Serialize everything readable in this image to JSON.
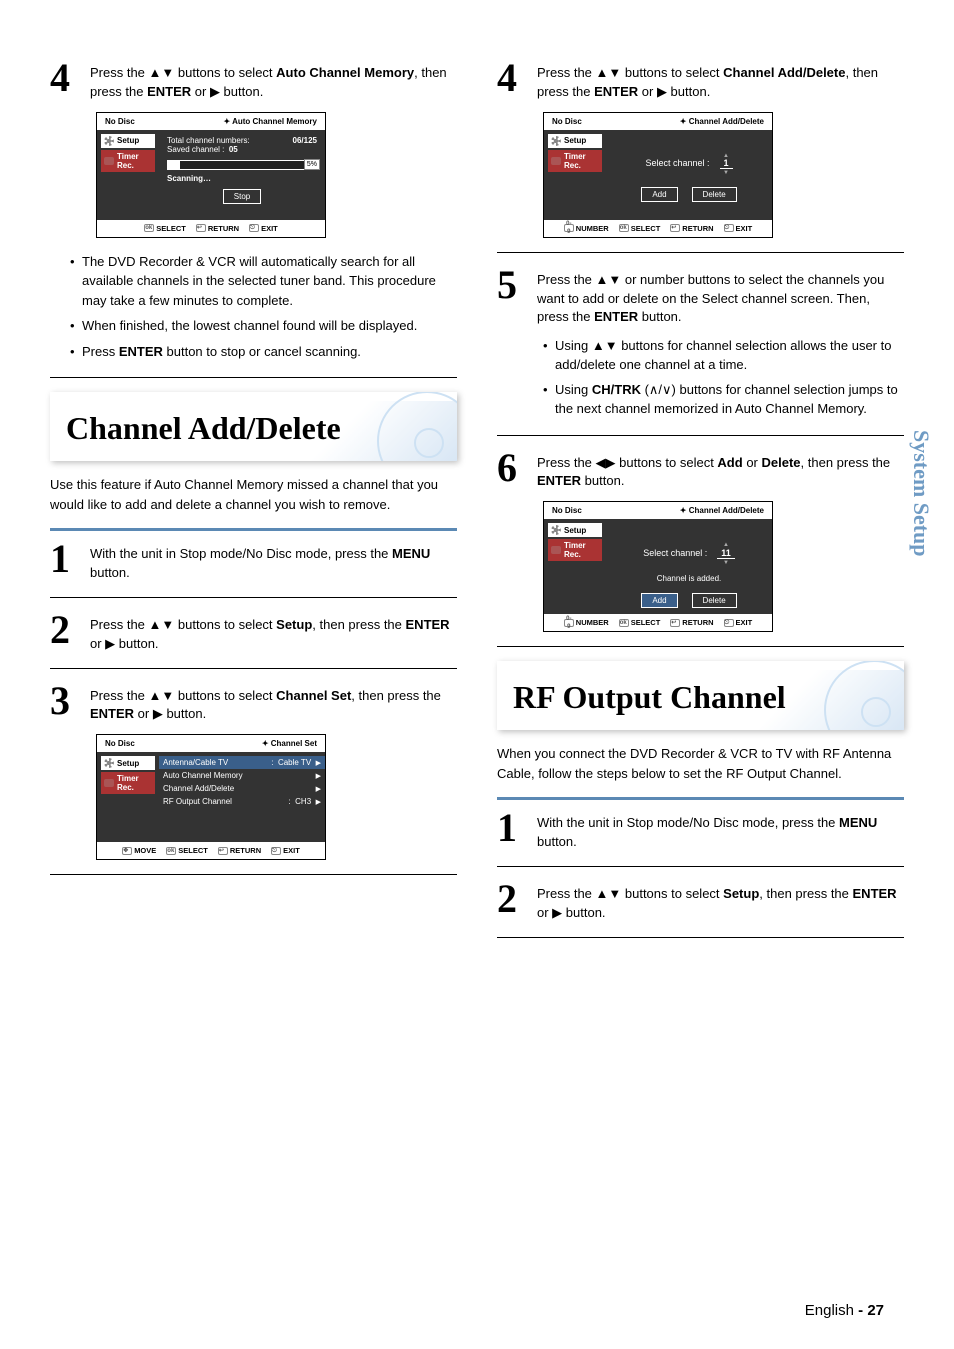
{
  "side_tab": "System Setup",
  "page_footer": {
    "lang": "English",
    "sep": " - ",
    "num": "27"
  },
  "left": {
    "step4": {
      "text_a": "Press the ▲▼ buttons to select ",
      "bold_a": "Auto Channel Memory",
      "text_b": ", then press the ",
      "bold_b": "ENTER",
      "text_c": " or ▶ button."
    },
    "osd1": {
      "no_disc": "No Disc",
      "title": "Auto Channel Memory",
      "side": {
        "setup": "Setup",
        "timer": "Timer Rec."
      },
      "total_label": "Total channel numbers:",
      "total_value": "06/125",
      "saved_label": "Saved channel :",
      "saved_value": "05",
      "percent": "5%",
      "scanning": "Scanning…",
      "btn_stop": "Stop",
      "footer": {
        "select": "SELECT",
        "return": "RETURN",
        "exit": "EXIT"
      }
    },
    "bullets": {
      "b1": "The DVD Recorder & VCR will automatically search for all available channels in the selected tuner band. This procedure may take a few minutes to complete.",
      "b2": "When finished, the lowest channel found will be displayed.",
      "b3_a": "Press ",
      "b3_bold": "ENTER",
      "b3_b": " button to stop or cancel scanning."
    },
    "section_title": "Channel Add/Delete",
    "intro": "Use this feature if Auto Channel Memory missed a channel that you would like to add and delete a channel you wish to remove.",
    "step1": {
      "text_a": "With the unit in Stop mode/No Disc mode, press the ",
      "bold_a": "MENU",
      "text_b": " button."
    },
    "step2": {
      "text_a": "Press the ▲▼ buttons to select ",
      "bold_a": "Setup",
      "text_b": ", then press the ",
      "bold_b": "ENTER",
      "text_c": " or ▶ button."
    },
    "step3": {
      "text_a": "Press the ▲▼ buttons to select ",
      "bold_a": "Channel Set",
      "text_b": ", then press the ",
      "bold_b": "ENTER",
      "text_c": " or ▶ button."
    },
    "osd2": {
      "no_disc": "No Disc",
      "title": "Channel Set",
      "side": {
        "setup": "Setup",
        "timer": "Timer Rec."
      },
      "rows": {
        "r1_label": "Antenna/Cable TV",
        "r1_value": "Cable TV",
        "r2": "Auto Channel Memory",
        "r3": "Channel Add/Delete",
        "r4_label": "RF Output Channel",
        "r4_value": "CH3"
      },
      "footer": {
        "move": "MOVE",
        "select": "SELECT",
        "return": "RETURN",
        "exit": "EXIT"
      }
    }
  },
  "right": {
    "step4": {
      "text_a": "Press the ▲▼ buttons to select ",
      "bold_a": "Channel Add/Delete",
      "text_b": ", then press the ",
      "bold_b": "ENTER",
      "text_c": " or ▶ button."
    },
    "osd1": {
      "no_disc": "No Disc",
      "title": "Channel Add/Delete",
      "side": {
        "setup": "Setup",
        "timer": "Timer Rec."
      },
      "select_label": "Select channel :",
      "select_value": "1",
      "btn_add": "Add",
      "btn_delete": "Delete",
      "footer": {
        "number": "NUMBER",
        "select": "SELECT",
        "return": "RETURN",
        "exit": "EXIT"
      }
    },
    "step5": {
      "text_a": "Press the ▲▼ or number buttons to select the channels you want to add or delete on the Select channel screen. Then, press the ",
      "bold_a": "ENTER",
      "text_b": " button."
    },
    "sub_bullets": {
      "b1": "Using  ▲▼ buttons for channel selection allows the user to add/delete one channel at a time.",
      "b2_a": "Using ",
      "b2_bold": "CH/TRK",
      "b2_b": " (∧/∨) buttons for channel selection jumps to the next channel memorized in Auto Channel Memory."
    },
    "step6": {
      "text_a": "Press the ◀▶ buttons to select ",
      "bold_a": "Add",
      "text_b": " or ",
      "bold_b": "Delete",
      "text_c": ", then press the ",
      "bold_c": "ENTER",
      "text_d": " button."
    },
    "osd2": {
      "no_disc": "No Disc",
      "title": "Channel Add/Delete",
      "side": {
        "setup": "Setup",
        "timer": "Timer Rec."
      },
      "select_label": "Select channel :",
      "select_value": "11",
      "msg": "Channel is added.",
      "btn_add": "Add",
      "btn_delete": "Delete",
      "footer": {
        "number": "NUMBER",
        "select": "SELECT",
        "return": "RETURN",
        "exit": "EXIT"
      }
    },
    "section_title": "RF Output Channel",
    "intro": "When you connect the DVD Recorder & VCR to TV with RF Antenna Cable, follow the steps below to set the RF Output Channel.",
    "step1": {
      "text_a": "With the unit in Stop mode/No Disc mode, press the ",
      "bold_a": "MENU",
      "text_b": " button."
    },
    "step2": {
      "text_a": "Press the ▲▼ buttons to select ",
      "bold_a": "Setup",
      "text_b": ", then press the ",
      "bold_b": "ENTER",
      "text_c": " or ▶ button."
    }
  }
}
